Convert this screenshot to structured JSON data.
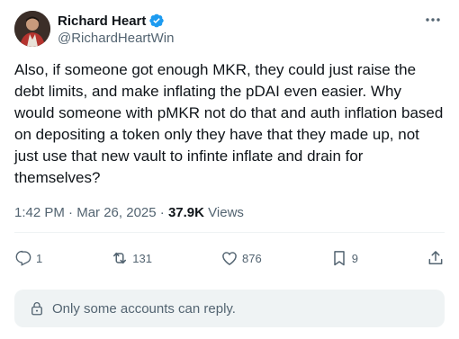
{
  "author": {
    "display_name": "Richard Heart",
    "handle": "@RichardHeartWin"
  },
  "tweet": {
    "text": "Also, if someone got enough MKR, they could just raise the debt limits, and make inflating the pDAI even easier. Why would someone with pMKR not do that and auth inflation based on depositing a token only they have that they made up, not just use that new vault to infinte inflate and drain for themselves?",
    "time": "1:42 PM",
    "date": "Mar 26, 2025",
    "separator": "·",
    "views_count": "37.9K",
    "views_label": "Views"
  },
  "actions": {
    "replies": "1",
    "reposts": "131",
    "likes": "876",
    "bookmarks": "9"
  },
  "reply_restriction": {
    "text": "Only some accounts can reply."
  },
  "colors": {
    "verified_blue": "#1d9bf0",
    "secondary_text": "#536471",
    "primary_text": "#0f1419"
  },
  "icons": [
    "verified-badge-icon",
    "more-icon",
    "reply-icon",
    "repost-icon",
    "like-icon",
    "bookmark-icon",
    "share-icon",
    "lock-icon"
  ]
}
